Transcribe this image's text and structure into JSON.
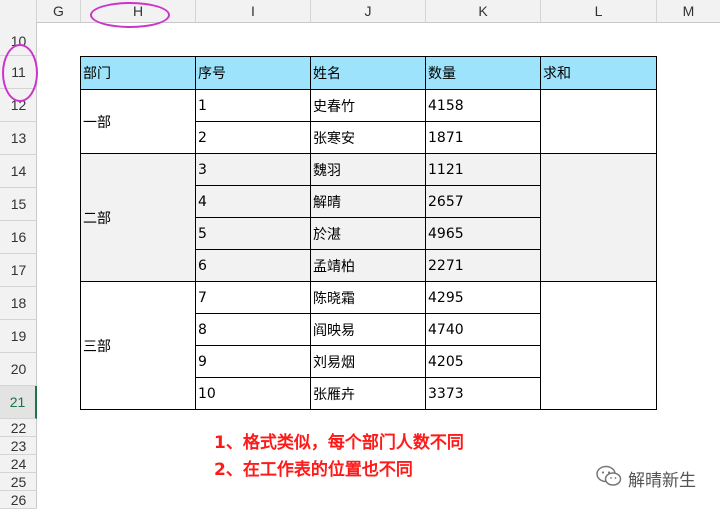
{
  "columns": [
    "G",
    "H",
    "I",
    "J",
    "K",
    "L",
    "M"
  ],
  "rows": [
    "10",
    "11",
    "12",
    "13",
    "14",
    "15",
    "16",
    "17",
    "18",
    "19",
    "20",
    "21",
    "22",
    "23",
    "24",
    "25",
    "26"
  ],
  "active_row": "21",
  "table": {
    "headers": [
      "部门",
      "序号",
      "姓名",
      "数量",
      "求和"
    ],
    "groups": [
      {
        "dept": "一部",
        "rows": [
          {
            "no": "1",
            "name": "史春竹",
            "qty": "4158"
          },
          {
            "no": "2",
            "name": "张寒安",
            "qty": "1871"
          }
        ]
      },
      {
        "dept": "二部",
        "rows": [
          {
            "no": "3",
            "name": "魏羽",
            "qty": "1121"
          },
          {
            "no": "4",
            "name": "解晴",
            "qty": "2657"
          },
          {
            "no": "5",
            "name": "於湛",
            "qty": "4965"
          },
          {
            "no": "6",
            "name": "孟靖柏",
            "qty": "2271"
          }
        ]
      },
      {
        "dept": "三部",
        "rows": [
          {
            "no": "7",
            "name": "陈晓霜",
            "qty": "4295"
          },
          {
            "no": "8",
            "name": "阎映易",
            "qty": "4740"
          },
          {
            "no": "9",
            "name": "刘易烟",
            "qty": "4205"
          },
          {
            "no": "10",
            "name": "张雁卉",
            "qty": "3373"
          }
        ]
      }
    ]
  },
  "annotations": [
    "1、格式类似，每个部门人数不同",
    "2、在工作表的位置也不同"
  ],
  "watermark": {
    "text": "解晴新生",
    "icon": "wechat-icon"
  },
  "colors": {
    "header_fill": "#9de3fb",
    "shaded_fill": "#f2f2f2",
    "annotation": "#ff1a1a",
    "highlight_oval": "#cc33cc",
    "active_row": "#217346"
  }
}
